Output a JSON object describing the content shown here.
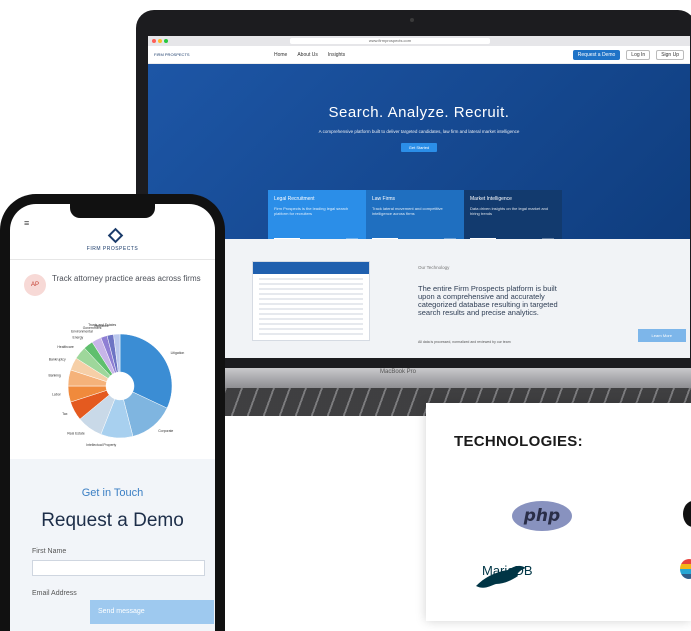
{
  "laptop": {
    "brand": "MacBook Pro",
    "browser": {
      "url": "www.firmprospects.com"
    },
    "nav": {
      "logo": "FIRM PROSPECTS",
      "links": [
        "Home",
        "About Us",
        "Insights"
      ],
      "cta": "Request a Demo",
      "login": "Log In",
      "signup": "Sign Up"
    },
    "hero": {
      "title": "Search. Analyze. Recruit.",
      "subtitle": "A comprehensive platform built to deliver targeted candidates, law firm and lateral market intelligence",
      "button": "Get Started"
    },
    "cards": [
      {
        "title": "Legal Recruitment",
        "text": "Firm Prospects is the leading legal search platform for recruiters",
        "button": "Learn More",
        "color": "#2b8ee8"
      },
      {
        "title": "Law Firms",
        "text": "Track lateral movement and competitive intelligence across firms",
        "button": "Learn More",
        "color": "#1f6fc0"
      },
      {
        "title": "Market Intelligence",
        "text": "Data driven insights on the legal market and hiring trends",
        "button": "Learn More",
        "color": "#123a6e"
      }
    ],
    "section2": {
      "label": "Our Technology",
      "text": "The entire Firm Prospects platform is built upon a comprehensive and accurately categorized database resulting in targeted search results and precise analytics.",
      "small": "All data is processed, normalized and reviewed by our team",
      "button": "Learn More"
    }
  },
  "phone": {
    "logo": "FIRM PROSPECTS",
    "badge": "AP",
    "tracking_text": "Track attorney practice areas across firms",
    "pie_labels": [
      "Litigation",
      "Corporate",
      "Intellectual Property",
      "Real Estate",
      "Tax",
      "Labor",
      "Banking",
      "Bankruptcy",
      "Healthcare",
      "Energy",
      "Environmental",
      "Government",
      "Insurance",
      "Trusts and Estates"
    ],
    "get_in_touch": "Get in Touch",
    "request_demo": "Request a Demo",
    "first_name_label": "First Name",
    "email_label": "Email Address",
    "send_button": "Send message"
  },
  "chart_data": {
    "type": "pie",
    "title": "",
    "categories": [
      "Litigation",
      "Corporate",
      "Intellectual Property",
      "Real Estate",
      "Tax",
      "Labor",
      "Banking",
      "Bankruptcy",
      "Healthcare",
      "Energy",
      "Environmental",
      "Government",
      "Insurance",
      "Trusts and Estates"
    ],
    "values": [
      32,
      14,
      10,
      8,
      6,
      5,
      5,
      4,
      4,
      3,
      3,
      2,
      2,
      2
    ],
    "colors": [
      "#3b8dd4",
      "#7fb5e0",
      "#a8d0ef",
      "#c9d9e8",
      "#e45a1f",
      "#f08a3c",
      "#f5b27a",
      "#f6cfa7",
      "#9ed79b",
      "#5fbf6e",
      "#c7b5e8",
      "#8f7fd4",
      "#6d74c4",
      "#b9c7ee"
    ]
  },
  "technologies": {
    "title": "TECHNOLOGIES:",
    "php": "php",
    "mariadb": "MariaDB"
  }
}
